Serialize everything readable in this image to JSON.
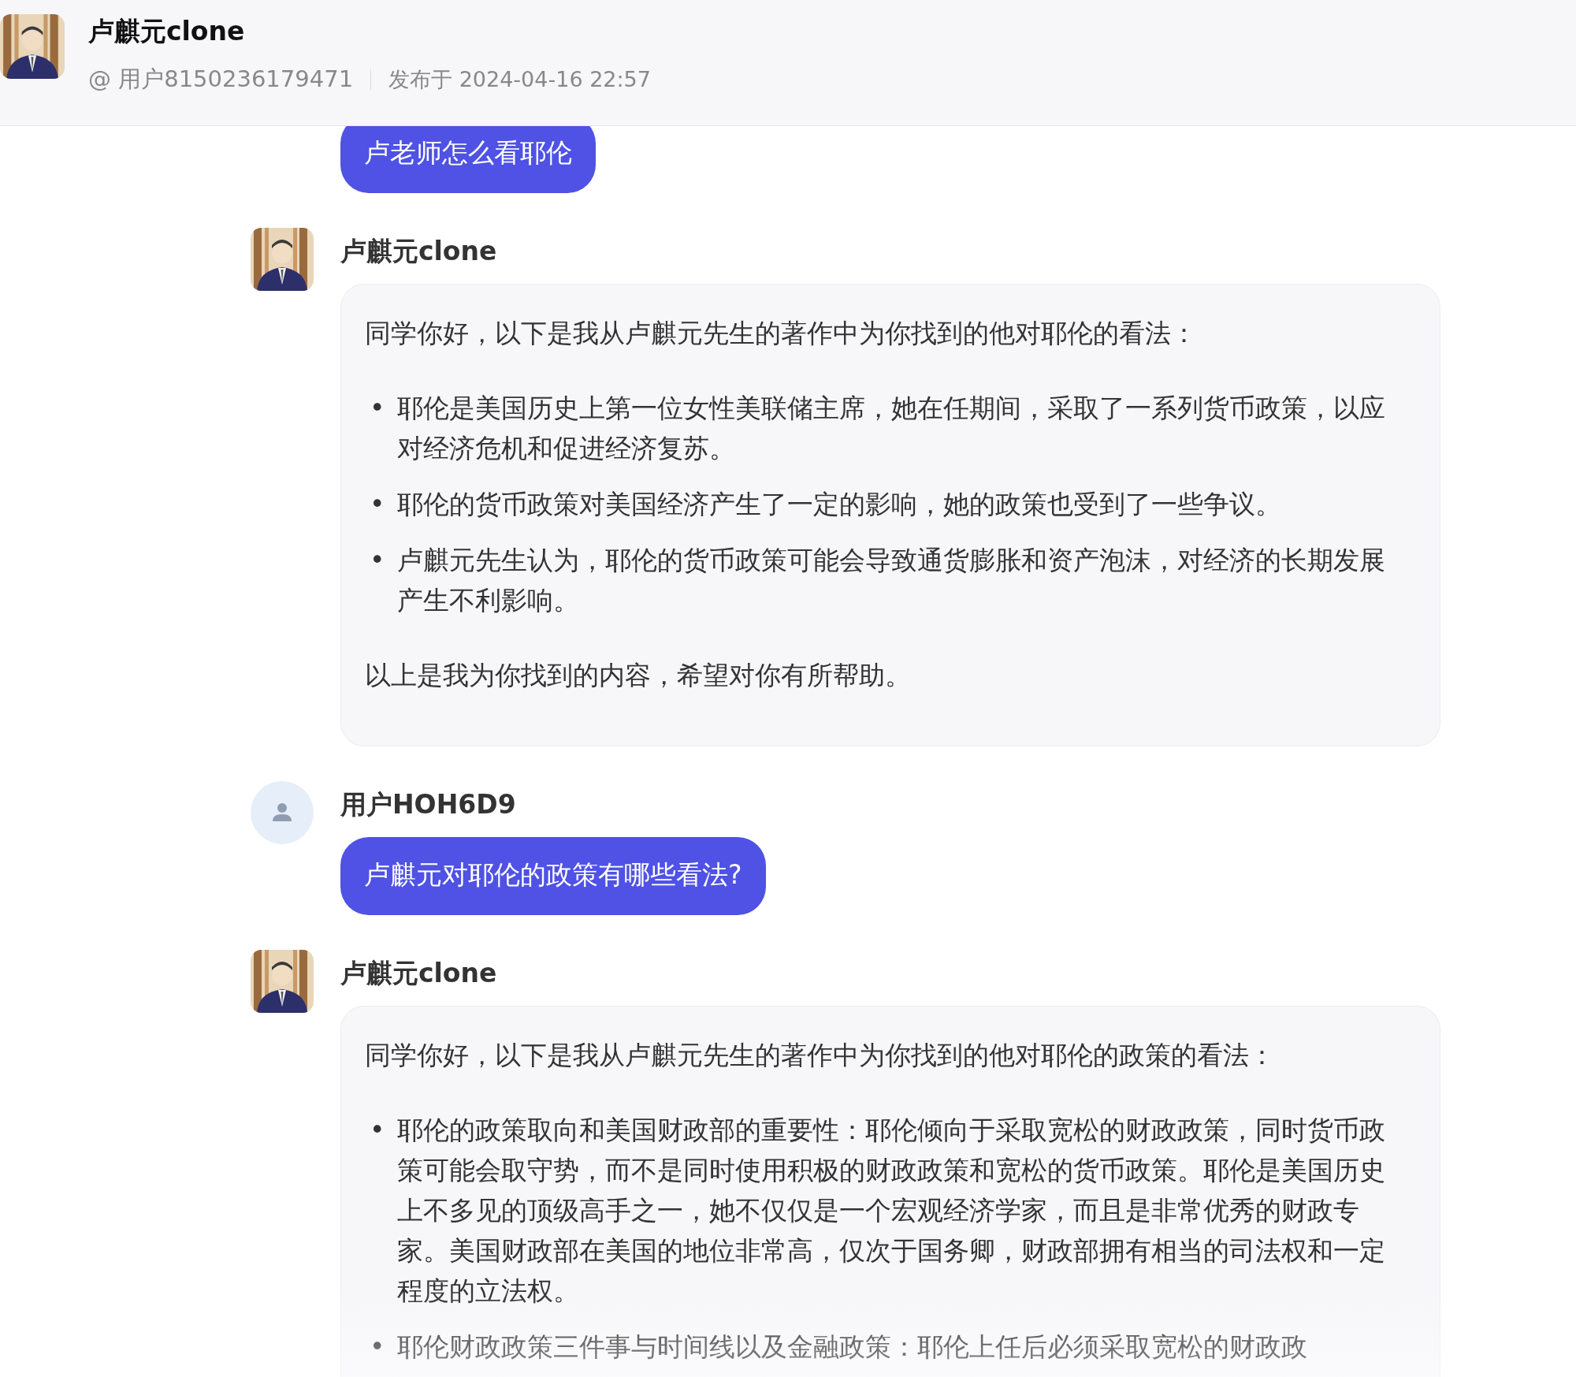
{
  "header": {
    "title": "卢麒元clone",
    "handle": "@ 用户8150236179471",
    "published": "发布于 2024-04-16 22:57"
  },
  "messages": [
    {
      "kind": "user",
      "text": "卢老师怎么看耶伦"
    },
    {
      "kind": "bot",
      "name": "卢麒元clone",
      "blocks": [
        {
          "kind": "paragraph",
          "text": "同学你好，以下是我从卢麒元先生的著作中为你找到的他对耶伦的看法："
        },
        {
          "kind": "list",
          "marker": "•",
          "items": [
            "耶伦是美国历史上第一位女性美联储主席，她在任期间，采取了一系列货币政策，以应对经济危机和促进经济复苏。",
            "耶伦的货币政策对美国经济产生了一定的影响，她的政策也受到了一些争议。",
            "卢麒元先生认为，耶伦的货币政策可能会导致通货膨胀和资产泡沫，对经济的长期发展产生不利影响。"
          ]
        },
        {
          "kind": "paragraph",
          "text": "以上是我为你找到的内容，希望对你有所帮助。"
        }
      ]
    },
    {
      "kind": "user",
      "name": "用户HOH6D9",
      "text": "卢麒元对耶伦的政策有哪些看法?"
    },
    {
      "kind": "bot",
      "name": "卢麒元clone",
      "blocks": [
        {
          "kind": "paragraph",
          "text": "同学你好，以下是我从卢麒元先生的著作中为你找到的他对耶伦的政策的看法："
        },
        {
          "kind": "list",
          "marker": "•",
          "items": [
            "耶伦的政策取向和美国财政部的重要性：耶伦倾向于采取宽松的财政政策，同时货币政策可能会取守势，而不是同时使用积极的财政政策和宽松的货币政策。耶伦是美国历史上不多见的顶级高手之一，她不仅仅是一个宏观经济学家，而且是非常优秀的财政专家。美国财政部在美国的地位非常高，仅次于国务卿，财政部拥有相当的司法权和一定程度的立法权。",
            "耶伦财政政策三件事与时间线以及金融政策：耶伦上任后必须采取宽松的财政政"
          ]
        }
      ]
    }
  ]
}
